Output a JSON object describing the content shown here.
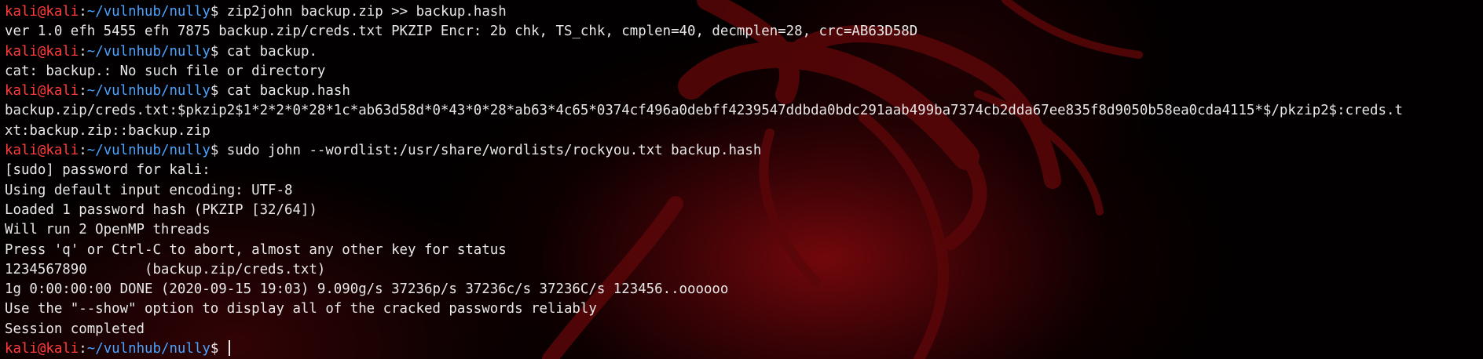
{
  "prompt": {
    "user": "kali",
    "at": "@",
    "host": "kali",
    "colon": ":",
    "path": "~/vulnhub/nully",
    "dollar": "$"
  },
  "colors": {
    "prompt_user": "#ff3b3b",
    "prompt_path": "#4aa3ff",
    "text": "#e8e8e8",
    "background": "#020000",
    "wallpaper_accent": "#7a080c"
  },
  "wallpaper_icon": "kali-dragon-icon",
  "lines": [
    {
      "type": "prompt",
      "command": " zip2john backup.zip >> backup.hash"
    },
    {
      "type": "output",
      "text": "ver 1.0 efh 5455 efh 7875 backup.zip/creds.txt PKZIP Encr: 2b chk, TS_chk, cmplen=40, decmplen=28, crc=AB63D58D"
    },
    {
      "type": "prompt",
      "command": " cat backup."
    },
    {
      "type": "output",
      "text": "cat: backup.: No such file or directory"
    },
    {
      "type": "prompt",
      "command": " cat backup.hash"
    },
    {
      "type": "output",
      "text": "backup.zip/creds.txt:$pkzip2$1*2*2*0*28*1c*ab63d58d*0*43*0*28*ab63*4c65*0374cf496a0debff4239547ddbda0bdc291aab499ba7374cb2dda67ee835f8d9050b58ea0cda4115*$/pkzip2$:creds.t"
    },
    {
      "type": "output",
      "text": "xt:backup.zip::backup.zip"
    },
    {
      "type": "prompt",
      "command": " sudo john --wordlist:/usr/share/wordlists/rockyou.txt backup.hash"
    },
    {
      "type": "output",
      "text": "[sudo] password for kali:"
    },
    {
      "type": "output",
      "text": "Using default input encoding: UTF-8"
    },
    {
      "type": "output",
      "text": "Loaded 1 password hash (PKZIP [32/64])"
    },
    {
      "type": "output",
      "text": "Will run 2 OpenMP threads"
    },
    {
      "type": "output",
      "text": "Press 'q' or Ctrl-C to abort, almost any other key for status"
    },
    {
      "type": "output",
      "text": "1234567890       (backup.zip/creds.txt)"
    },
    {
      "type": "output",
      "text": "1g 0:00:00:00 DONE (2020-09-15 19:03) 9.090g/s 37236p/s 37236c/s 37236C/s 123456..oooooo"
    },
    {
      "type": "output",
      "text": "Use the \"--show\" option to display all of the cracked passwords reliably"
    },
    {
      "type": "output",
      "text": "Session completed"
    },
    {
      "type": "prompt",
      "command": " "
    }
  ]
}
